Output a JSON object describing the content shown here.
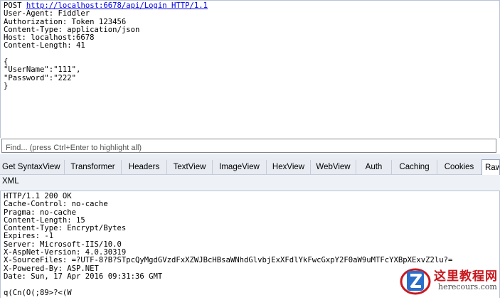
{
  "request": {
    "method": "POST",
    "url": "http://localhost:6678/api/Login",
    "protocol": "HTTP/1.1",
    "lines": [
      "User-Agent: Fiddler",
      "Authorization: Token 123456",
      "Content-Type: application/json",
      "Host: localhost:6678",
      "Content-Length: 41",
      "",
      "{",
      "\"UserName\":\"111\",",
      "\"Password\":\"222\"",
      "}"
    ]
  },
  "find": {
    "placeholder": "Find... (press Ctrl+Enter to highlight all)"
  },
  "tabs": [
    {
      "label": "Get SyntaxView"
    },
    {
      "label": "Transformer"
    },
    {
      "label": "Headers"
    },
    {
      "label": "TextView"
    },
    {
      "label": "ImageView"
    },
    {
      "label": "HexView"
    },
    {
      "label": "WebView"
    },
    {
      "label": "Auth"
    },
    {
      "label": "Caching"
    },
    {
      "label": "Cookies"
    },
    {
      "label": "Raw"
    }
  ],
  "tabs2": [
    {
      "label": "XML"
    }
  ],
  "response": {
    "lines": [
      "HTTP/1.1 200 OK",
      "Cache-Control: no-cache",
      "Pragma: no-cache",
      "Content-Length: 15",
      "Content-Type: Encrypt/Bytes",
      "Expires: -1",
      "Server: Microsoft-IIS/10.0",
      "X-AspNet-Version: 4.0.30319",
      "X-SourceFiles: =?UTF-8?B?STpcQyMgdGVzdFxXZWJBcHBsaWNhdGlvbjExXFdlYkFwcGxpY2F0aW9uMTFcYXBpXExvZ2lu?=",
      "X-Powered-By: ASP.NET",
      "Date: Sun, 17 Apr 2016 09:31:36 GMT",
      "",
      "q(Cn(O(;89>?<(W"
    ]
  },
  "watermark": {
    "text_cn": "这里教程网",
    "text_en": "herecours.com"
  }
}
